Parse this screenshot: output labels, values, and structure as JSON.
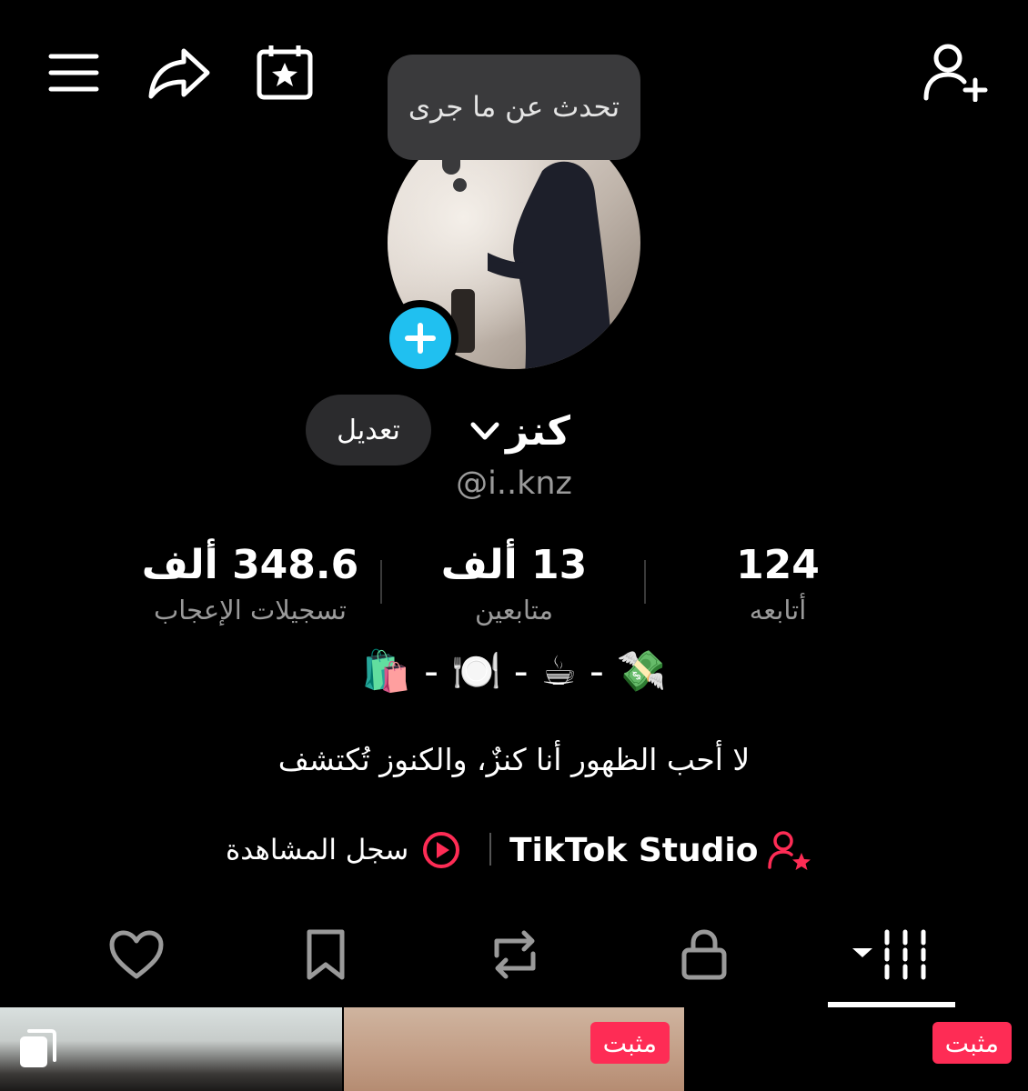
{
  "tooltip": {
    "text": "تحدث عن ما جرى"
  },
  "profile": {
    "display_name": "كنز",
    "username": "@i..knz",
    "edit_label": "تعديل"
  },
  "stats": {
    "likes": {
      "value": "348.6 ألف",
      "label": "تسجيلات الإعجاب"
    },
    "followers": {
      "value": "13 ألف",
      "label": "متابعين"
    },
    "following": {
      "value": "124",
      "label": "أتابعه"
    }
  },
  "bio": {
    "emoji_line": "🛍️ - 🍽️ - ☕ - 💸",
    "text": "لا أحب الظهور أنا كنزٌ، والكنوز تُكتشف"
  },
  "links": {
    "studio": "TikTok Studio",
    "history": "سجل المشاهدة"
  },
  "tabs": [
    "videos",
    "private",
    "reposts",
    "saved",
    "liked"
  ],
  "videos": [
    {
      "pinned": false,
      "multi": true
    },
    {
      "pinned": true,
      "badge": "مثبت"
    },
    {
      "pinned": true,
      "badge": "مثبت"
    }
  ],
  "colors": {
    "accent": "#fe2c55",
    "plus": "#20c0f0",
    "background": "#000000"
  }
}
